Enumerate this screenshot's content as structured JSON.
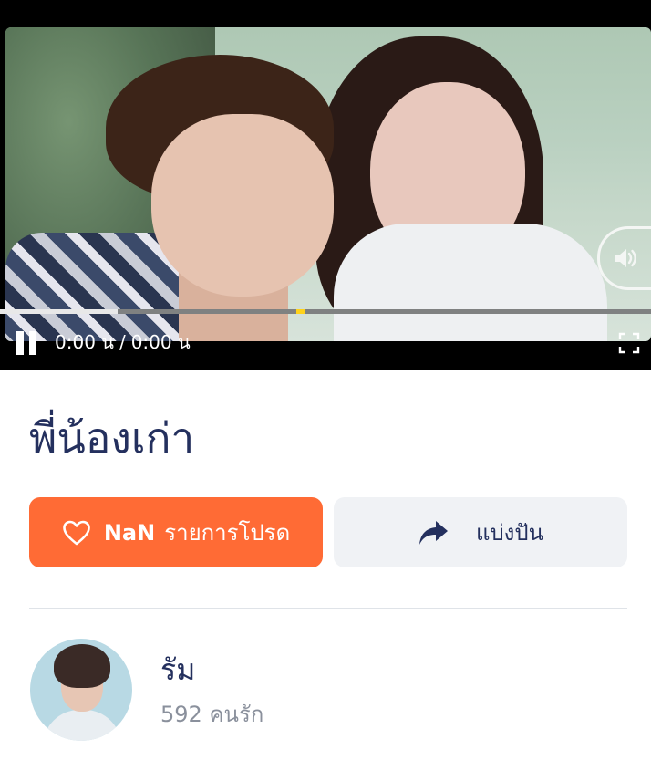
{
  "player": {
    "current_time": "0:00 น",
    "separator": "/",
    "duration": "0:00 น",
    "progress_fraction": 0.18,
    "marker_fraction": 0.455,
    "play_state_icon": "pause-icon",
    "sound_icon": "volume-icon",
    "fullscreen_icon": "fullscreen-icon"
  },
  "song": {
    "title": "พี่น้องเก่า"
  },
  "actions": {
    "favorite": {
      "count": "NaN",
      "label": "รายการโปรด",
      "icon": "heart-icon",
      "color": "#ff6b35"
    },
    "share": {
      "label": "แบ่งปัน",
      "icon": "share-arrow-icon",
      "color": "#f0f2f5"
    }
  },
  "artist": {
    "name": "รัม",
    "followers": "592 คนรัก"
  },
  "colors": {
    "primary_text": "#24305e",
    "muted_text": "#8a909c",
    "accent": "#ff6b35"
  }
}
